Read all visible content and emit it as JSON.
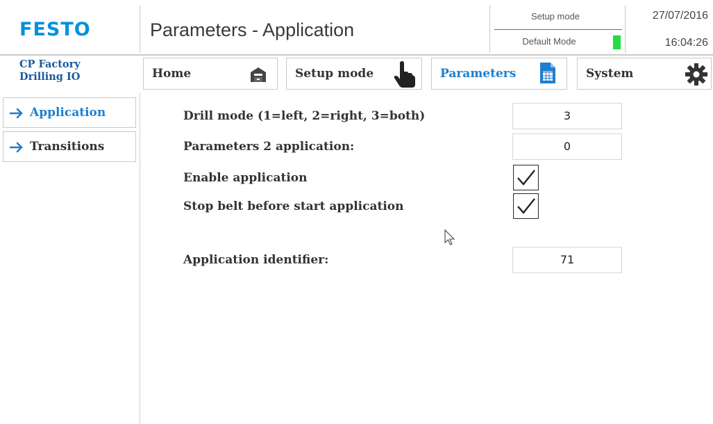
{
  "header": {
    "logo": "FESTO",
    "title": "Parameters - Application",
    "setup_mode": "Setup mode",
    "default_mode": "Default Mode",
    "date": "27/07/2016",
    "time": "16:04:26",
    "status_color": "#22dd44"
  },
  "station": {
    "line1": "CP Factory",
    "line2": "Drilling IO"
  },
  "nav": {
    "home": {
      "label": "Home",
      "icon": "home-icon"
    },
    "setup": {
      "label": "Setup mode",
      "icon": "hand-pointer-icon"
    },
    "parameters": {
      "label": "Parameters",
      "icon": "document-table-icon"
    },
    "system": {
      "label": "System",
      "icon": "gear-icon"
    }
  },
  "sidebar": {
    "items": [
      {
        "label": "Application",
        "icon": "arrow-right-icon"
      },
      {
        "label": "Transitions",
        "icon": "arrow-right-icon"
      }
    ]
  },
  "params": {
    "drill_mode": {
      "label": "Drill mode (1=left, 2=right, 3=both)",
      "value": "3"
    },
    "param2": {
      "label": "Parameters 2 application:",
      "value": "0"
    },
    "enable": {
      "label": "Enable application",
      "checked": true
    },
    "stop_belt": {
      "label": "Stop belt before start application",
      "checked": true
    },
    "identifier": {
      "label": "Application identifier:",
      "value": "71"
    }
  },
  "colors": {
    "accent": "#0091dc",
    "active_text": "#1d7fd0"
  }
}
